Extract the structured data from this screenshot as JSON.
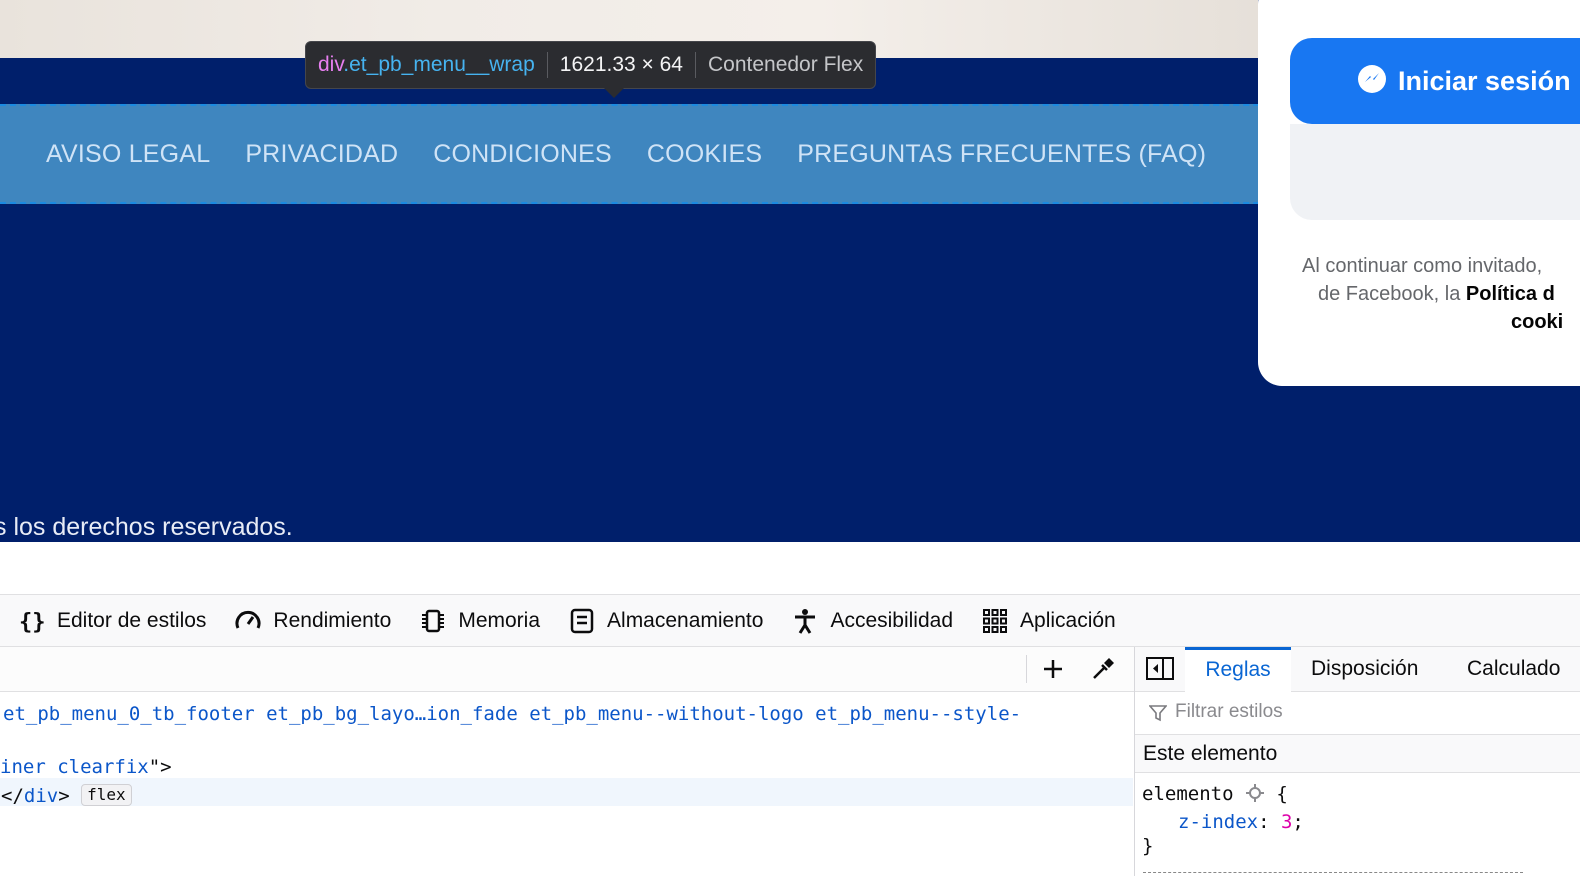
{
  "tooltip": {
    "tag": "div",
    "class_name": ".et_pb_menu__wrap",
    "dimensions": "1621.33 × 64",
    "type": "Contenedor Flex"
  },
  "footer_menu": {
    "items": [
      {
        "label": "AVISO LEGAL"
      },
      {
        "label": "PRIVACIDAD"
      },
      {
        "label": "CONDICIONES"
      },
      {
        "label": "COOKIES"
      },
      {
        "label": "PREGUNTAS FRECUENTES (FAQ)"
      }
    ]
  },
  "copyright": "s los derechos reservados.",
  "facebook": {
    "login_label": "Iniciar sesión",
    "terms_line1": "Al continuar como invitado,",
    "terms_line2_a": "de Facebook, la",
    "terms_line2_b": "Política d",
    "terms_line3": "cooki",
    "accent": "#1877f2"
  },
  "devtools": {
    "tabs": [
      {
        "label": "Editor de estilos",
        "icon": "braces-icon"
      },
      {
        "label": "Rendimiento",
        "icon": "gauge-icon"
      },
      {
        "label": "Memoria",
        "icon": "memory-chip-icon"
      },
      {
        "label": "Almacenamiento",
        "icon": "storage-icon"
      },
      {
        "label": "Accesibilidad",
        "icon": "accessibility-icon"
      },
      {
        "label": "Aplicación",
        "icon": "app-grid-icon"
      }
    ],
    "markup": {
      "line1": "et_pb_menu_0_tb_footer et_pb_bg_layo…ion_fade et_pb_menu--without-logo et_pb_menu--style-",
      "line2_class": "iner clearfix",
      "line2_end": "\">",
      "line3_open": "</",
      "line3_tag": "div",
      "line3_close": ">",
      "badge": "flex"
    },
    "sidebar": {
      "tabs": [
        "Reglas",
        "Disposición",
        "Calculado"
      ],
      "active_tab": "Reglas",
      "filter_placeholder": "Filtrar estilos",
      "section_title": "Este elemento",
      "rule_selector": "elemento",
      "rule_open": "{",
      "rule_property": "z-index",
      "rule_value": "3",
      "rule_close": "}"
    }
  },
  "colors": {
    "page_background": "#001f6b",
    "menu_band": "#3f86bf",
    "highlight_border": "#1c8ae0",
    "devtools_accent": "#0a66d3"
  }
}
